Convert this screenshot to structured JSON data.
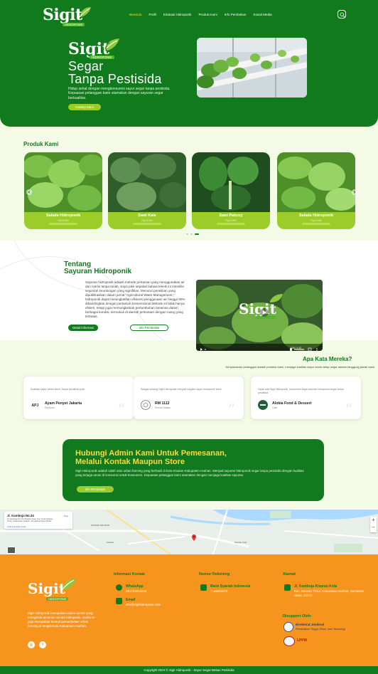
{
  "brand": {
    "name": "Sigit",
    "tagline": "HIDROPONIK"
  },
  "nav": {
    "items": [
      "Beranda",
      "Profil",
      "Edukasi Hidroponik",
      "Produk Kami",
      "Info Pembelian",
      "Sosial Media"
    ],
    "active": "Beranda"
  },
  "hero": {
    "title_line1": "Segar",
    "title_line2": "Tanpa Pestisida",
    "description": "Hidup sehat dengan mengkonsumsi sayur segar tanpa pestisida. Kepuasan pelanggan kami utamakan dengan sayuran segar berkualitas.",
    "button": "Katalog Kami"
  },
  "products": {
    "title": "Produk Kami",
    "items": [
      {
        "name": "Salada Hidroponik",
        "price": "Rp10.000",
        "link": "Selengkapnya"
      },
      {
        "name": "Sawi Kale",
        "price": "Rp10.000",
        "link": "Selengkapnya"
      },
      {
        "name": "Sawi Pakcoy",
        "price": "Rp10.000",
        "link": "Selengkapnya"
      },
      {
        "name": "Salada Hidroponik",
        "price": "Rp10.000",
        "link": "Selengkapnya"
      }
    ]
  },
  "about": {
    "title_line1": "Tentang",
    "title_line2": "Sayuran Hidroponik",
    "text": "Sayuran hidroponik adalah metode pertanian yang menggunakan air dan nutrisi tanpa tanah. Saya pikir sepakat bahwa teknik ini memiliki sejumlah keuntungan yang signifikan. Menurut penelitian yang dipublikasikan dalam jurnal \"Agricultural Water Management,\" hidroponik dapat meningkatkan efisiensi penggunaan air hingga 90% dibandingkan dengan pertanian konvensional.Metode ini tidak hanya efisien, tetapi juga memungkinkan pertumbuhan tanaman dalam berbagai kondisi, termasuk di daerah perkotaan dengan ruang yang terbatas.",
    "btn_detail": "Detail Informasi",
    "btn_info": "Info Pembelian",
    "video_time": "0:00 / 1:13"
  },
  "testimonials": {
    "title": "Apa Kata Mereka?",
    "subtitle": "Kenyamanan pelanggan adalah prioritas kami, menjaga kualitas sayur selalu tetap segar adalah tanggung jawab kami.",
    "items": [
      {
        "quote": "Kualitas sayur selalu fresh, tanpa pestisida pula",
        "name": "Ayam Penyet Jakarta",
        "role": "Restoran"
      },
      {
        "quote": "Sangat senang Sigit Hidroponik menjadi supplier sayur hidroponik kami",
        "name": "RM 1112",
        "role": "Rumah Makan"
      },
      {
        "quote": "Sejak ada Sigit Hidroponik, konsumen saya mencari hidroponik segar tanpa pestisida",
        "name": "Alokia Food & Dessert",
        "role": "Cafe"
      }
    ]
  },
  "cta": {
    "title_line1": "Hubungi Admin Kami Untuk Pemesanan,",
    "title_line2": "Melalui Kontak Maupun Store",
    "text": "Sigit Hidroponik adalah salah satu urban farming yang berhasil di kota Kisaran Kabupaten Asahan. Menjual sayuran hidroponik segar tanpa pestisida dengan kualitas yang terjaga aman di konsumsi untuk konsumen. Kepuasan pelanggan kami utamakan dengan menjaga kualitas sayuran.",
    "button": "Info Pembelian"
  },
  "map": {
    "place": "Jl. Kamboja No.34",
    "address": "Jl. Kamboja No.34, Kisaran Kota, Kec. Kota Kisaran Timur, Kabupaten Asahan, Sumatera Utara 21214",
    "directions": "Rute",
    "larger_map": "Lihat peta lebih besar"
  },
  "footer": {
    "about": "Sigit Hidroponik merupakan usaha rumah yang mengelola tanaman secara hidroponik, usaha ini juga merupakan bentuk pemanfaatan urban farming di tengah kota Kabupaten Asahan.",
    "contact_title": "Informasi Kontak",
    "whatsapp_label": "WhatsApp",
    "whatsapp_value": "081261816033",
    "email_label": "Email",
    "email_value": "info@sigithidroponik.com",
    "account_title": "Nomor Rekening",
    "bank_label": "Bank Syariah Indonesia",
    "bank_value": "7195563073",
    "address_title": "Alamat",
    "address_label": "Jl. Kamboja Kisaran Kota",
    "address_value": "Kec. Kisaran Timur, Kabupaten Asahan, Sumatera Utara, 21222",
    "support_title": "Disupport Oleh:",
    "support1_title": "Direktorat Jenderal",
    "support1_sub": "Pendidikan Tinggi, Riset, dan Teknologi",
    "support2_title": "LPPM",
    "copyright": "Copyright 2024 © Sigit Hidroponik - Sayur Segar Bebas Pestisida"
  },
  "colors": {
    "primary": "#107a1c",
    "accent": "#9ccc28",
    "highlight": "#ffd83a",
    "footer": "#f7941d",
    "background": "#f3fae6"
  }
}
